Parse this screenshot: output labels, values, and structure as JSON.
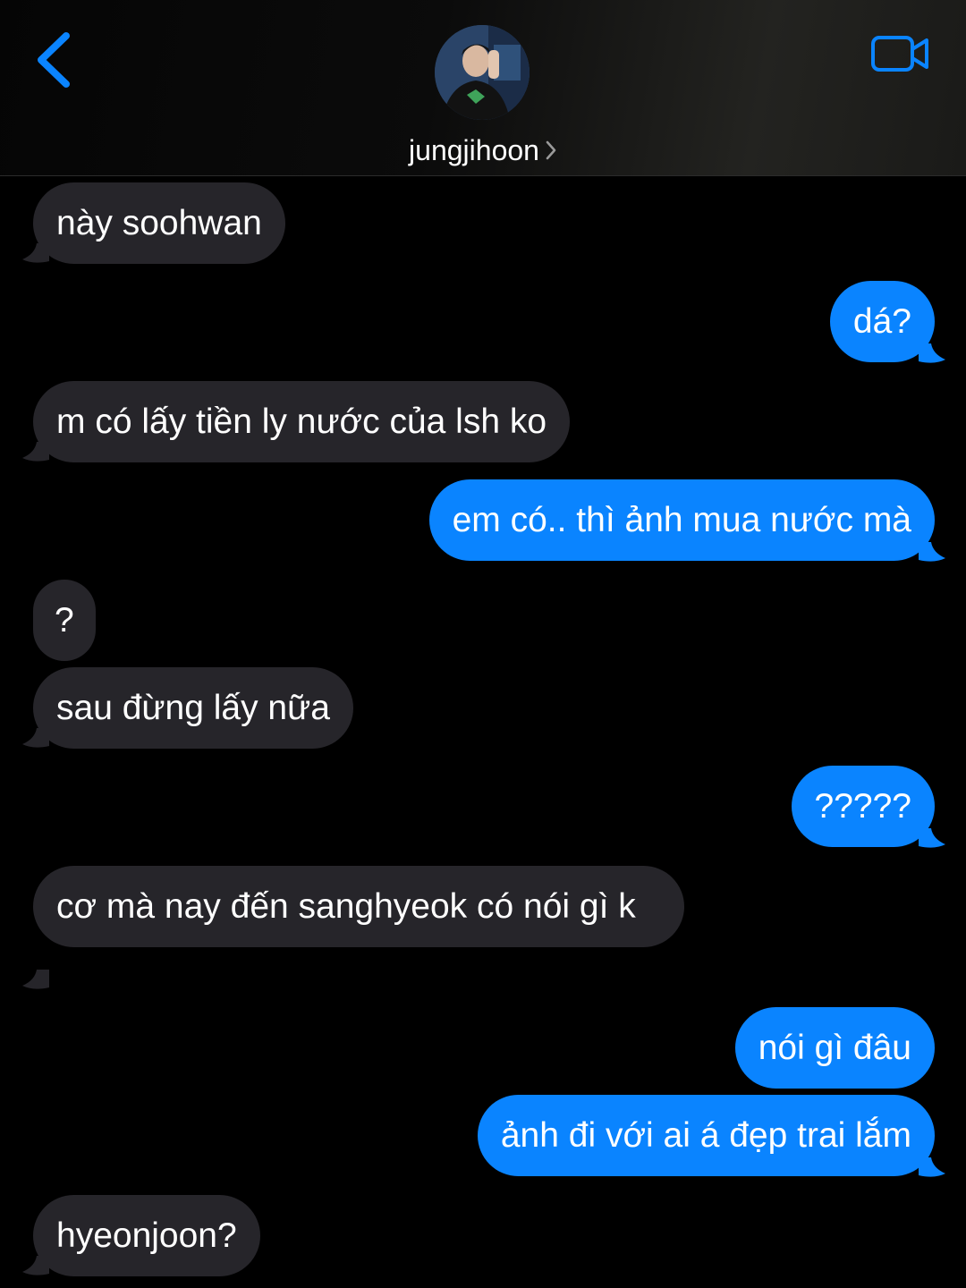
{
  "header": {
    "contact_name": "jungjihoon",
    "back_icon": "chevron-left-icon",
    "video_icon": "video-camera-icon",
    "accent_color": "#0a84ff"
  },
  "messages": [
    {
      "from": "them",
      "text": "này soohwan"
    },
    {
      "from": "me",
      "text": "dá?"
    },
    {
      "from": "them",
      "text": "m có lấy tiền ly nước của lsh ko"
    },
    {
      "from": "me",
      "text": "em có.. thì ảnh mua nước mà"
    },
    {
      "from": "them",
      "text": "?"
    },
    {
      "from": "them",
      "text": "sau đừng lấy nữa"
    },
    {
      "from": "me",
      "text": "?????"
    },
    {
      "from": "them",
      "text": "cơ mà nay đến sanghyeok có nói gì k"
    },
    {
      "from": "me",
      "text": "nói gì đâu"
    },
    {
      "from": "me",
      "text": "ảnh đi với ai á đẹp trai lắm"
    },
    {
      "from": "them",
      "text": "hyeonjoon?"
    }
  ],
  "colors": {
    "incoming_bubble": "#26252a",
    "outgoing_bubble": "#0a84ff",
    "background": "#000000"
  }
}
